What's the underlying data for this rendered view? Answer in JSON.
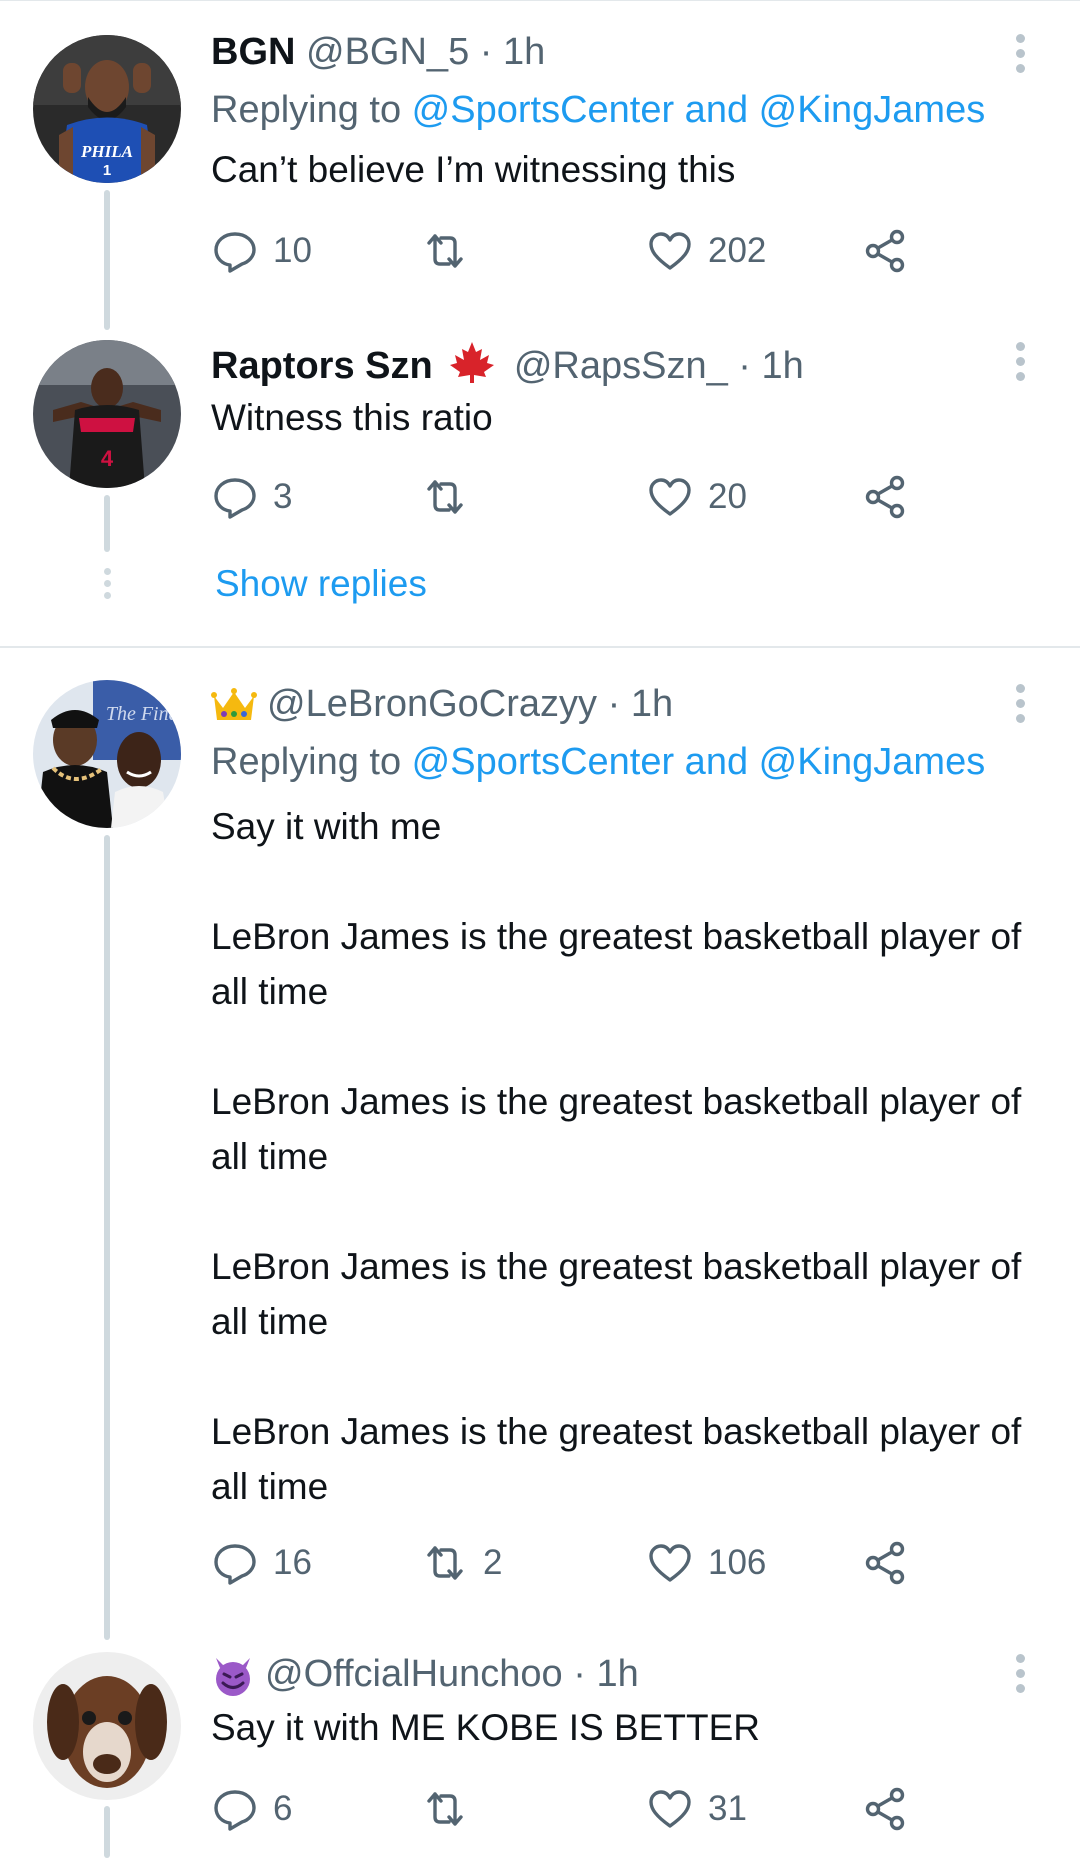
{
  "tweets": [
    {
      "name": "BGN",
      "handle": "@BGN_5",
      "time": "· 1h",
      "replying_prefix": "Replying to ",
      "replying_links": "@SportsCenter and @KingJames",
      "text": "Can’t believe I’m witnessing this",
      "replies": "10",
      "retweets": "",
      "likes": "202",
      "avatar_colors": [
        "#1e4fb4",
        "#c8102e"
      ]
    },
    {
      "name": "Raptors Szn",
      "name_emoji": "maple-leaf",
      "handle": "@RapsSzn_",
      "time": "· 1h",
      "text": "Witness this ratio",
      "replies": "3",
      "retweets": "",
      "likes": "20",
      "avatar_colors": [
        "#ce1141",
        "#1a1a1a"
      ]
    },
    {
      "name_emoji": "crown",
      "handle": "@LeBronGoCrazyy",
      "time": "· 1h",
      "replying_prefix": "Replying to ",
      "replying_links": "@SportsCenter and @KingJames",
      "text": "Say it with me\n\nLeBron James is the greatest basketball player of all time\n\nLeBron James is the greatest basketball player of all time\n\nLeBron James is the greatest basketball player of all time\n\nLeBron James is the greatest basketball player of all time",
      "replies": "16",
      "retweets": "2",
      "likes": "106",
      "avatar_colors": [
        "#3a5da8",
        "#e6c27a"
      ]
    },
    {
      "name_emoji": "smiling-devil",
      "handle": "@OffcialHunchoo",
      "time": "· 1h",
      "text": "Say it with ME KOBE IS BETTER",
      "replies": "6",
      "retweets": "",
      "likes": "31",
      "avatar_colors": [
        "#6b3e24",
        "#f2f2f2"
      ]
    }
  ],
  "show_replies": "Show replies",
  "colors": {
    "link": "#1d9bf0",
    "muted": "#536471",
    "text": "#0f1419",
    "thread_line": "#cfd9de"
  }
}
